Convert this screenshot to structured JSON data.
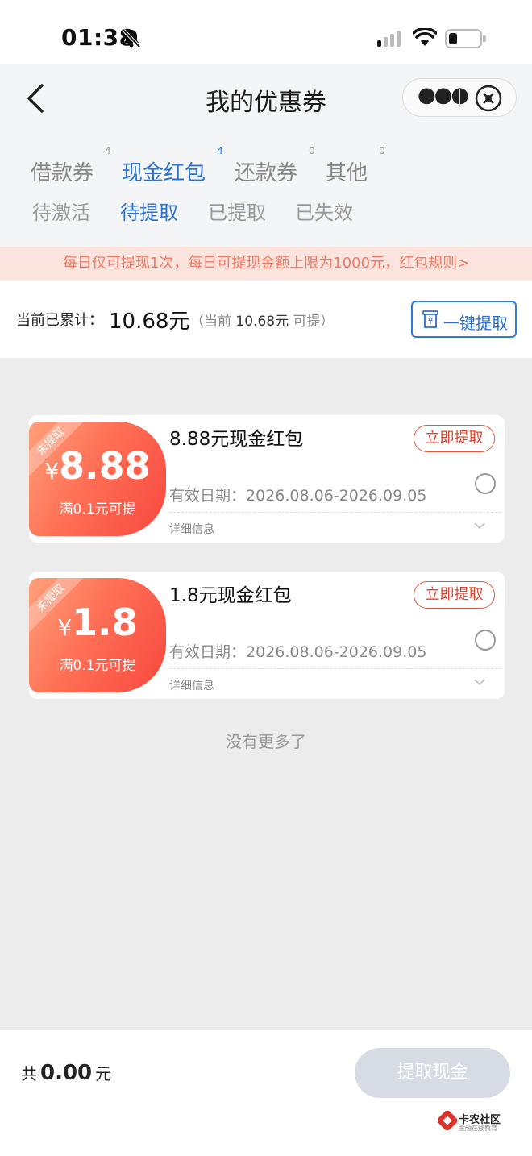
{
  "status_bar": {
    "time": "01:38",
    "icons": [
      "bell-muted-icon",
      "signal-icon",
      "wifi-icon",
      "battery-icon"
    ]
  },
  "header": {
    "title": "我的优惠券",
    "icons": {
      "back": "chevron-left-icon",
      "more": "more-icon",
      "close": "close-circle-icon"
    }
  },
  "tabs": [
    {
      "label": "借款券",
      "count": "4"
    },
    {
      "label": "现金红包",
      "count": "4",
      "active": true
    },
    {
      "label": "还款券",
      "count": "0"
    },
    {
      "label": "其他",
      "count": "0"
    }
  ],
  "subtabs": [
    {
      "label": "待激活"
    },
    {
      "label": "待提取",
      "active": true
    },
    {
      "label": "已提取"
    },
    {
      "label": "已失效"
    }
  ],
  "notice": "每日仅可提现1次，每日可提现金额上限为1000元，红包规则>",
  "summary": {
    "label": "当前已累计：",
    "value": "10.68元",
    "sub_prefix": "（当前",
    "sub_value": "10.68元",
    "sub_suffix": "可提）",
    "button": "一键提取"
  },
  "coupons": [
    {
      "ribbon": "未提取",
      "currency": "¥",
      "amount": "8.88",
      "threshold": "满0.1元可提",
      "title": "8.88元现金红包",
      "action": "立即提取",
      "validity_label": "有效日期：",
      "validity": "2026.08.06-2026.09.05",
      "detail": "详细信息"
    },
    {
      "ribbon": "未提取",
      "currency": "¥",
      "amount": "1.8",
      "threshold": "满0.1元可提",
      "title": "1.8元现金红包",
      "action": "立即提取",
      "validity_label": "有效日期：",
      "validity": "2026.08.06-2026.09.05",
      "detail": "详细信息"
    }
  ],
  "no_more": "没有更多了",
  "footer": {
    "total_prefix": "共",
    "total_value": "0.00",
    "total_unit": "元",
    "button": "提取现金",
    "logo_name": "卡农社区",
    "logo_tag": "金融在线教育"
  },
  "colors": {
    "accent": "#2a72d8",
    "coupon_red": "#f7483f",
    "notice_bg": "#fbe3de",
    "notice_text": "#f07a64",
    "button_disabled": "#d6dbe4"
  }
}
